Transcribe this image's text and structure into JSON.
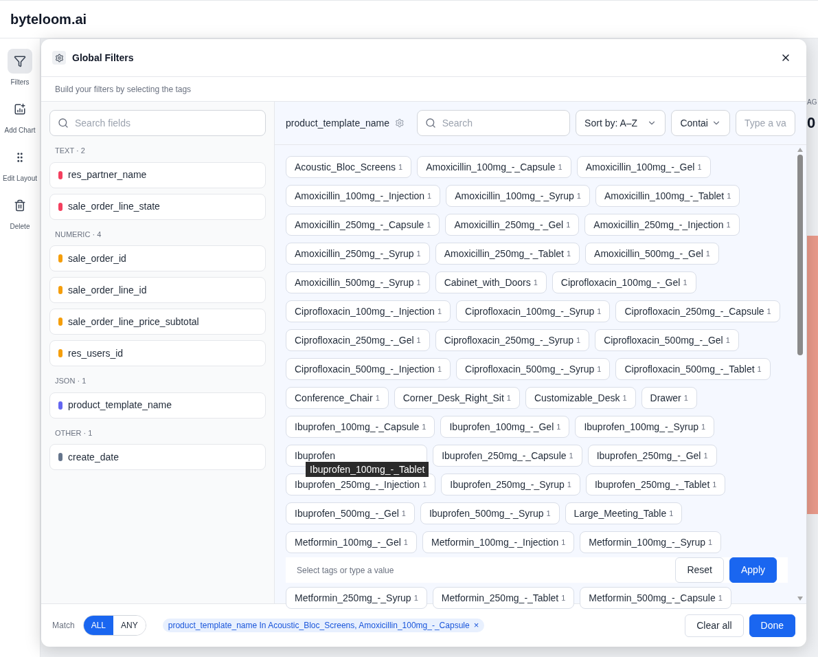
{
  "app": {
    "logo": "byteloom.ai"
  },
  "rail": [
    {
      "kind": "filter",
      "label": "Filters",
      "selected": true
    },
    {
      "kind": "chart",
      "label": "Add Chart",
      "selected": false
    },
    {
      "kind": "layout",
      "label": "Edit Layout",
      "selected": false
    },
    {
      "kind": "delete",
      "label": "Delete",
      "selected": false
    }
  ],
  "background": {
    "label": "AG",
    "value": "0"
  },
  "dialog": {
    "title": "Global Filters",
    "subtitle": "Build your filters by selecting the tags",
    "field_search": {
      "placeholder": "Search fields"
    },
    "groups": [
      {
        "title": "TEXT",
        "separator": "·",
        "count": "2",
        "fields": [
          {
            "name": "res_partner_name",
            "color": "#f43f5e"
          },
          {
            "name": "sale_order_line_state",
            "color": "#f43f5e"
          }
        ]
      },
      {
        "title": "NUMERIC",
        "separator": "·",
        "count": "4",
        "fields": [
          {
            "name": "sale_order_id",
            "color": "#f59e0b"
          },
          {
            "name": "sale_order_line_id",
            "color": "#f59e0b"
          },
          {
            "name": "sale_order_line_price_subtotal",
            "color": "#f59e0b"
          },
          {
            "name": "res_users_id",
            "color": "#f59e0b"
          }
        ]
      },
      {
        "title": "JSON",
        "separator": "·",
        "count": "1",
        "fields": [
          {
            "name": "product_template_name",
            "color": "#6366f1"
          }
        ]
      },
      {
        "title": "OTHER",
        "separator": "·",
        "count": "1",
        "fields": [
          {
            "name": "create_date",
            "color": "#64748b"
          }
        ]
      }
    ],
    "field_name": "product_template_name",
    "tag_search": {
      "placeholder": "Search"
    },
    "sort": "Sort by: A–Z",
    "operator": "Contai",
    "value_input": {
      "placeholder": "Type a va"
    },
    "tags": [
      {
        "label": "Acoustic_Bloc_Screens",
        "count": "1"
      },
      {
        "label": "Amoxicillin_100mg_-_Capsule",
        "count": "1"
      },
      {
        "label": "Amoxicillin_100mg_-_Gel",
        "count": "1"
      },
      {
        "label": "Amoxicillin_100mg_-_Injection",
        "count": "1"
      },
      {
        "label": "Amoxicillin_100mg_-_Syrup",
        "count": "1"
      },
      {
        "label": "Amoxicillin_100mg_-_Tablet",
        "count": "1"
      },
      {
        "label": "Amoxicillin_250mg_-_Capsule",
        "count": "1"
      },
      {
        "label": "Amoxicillin_250mg_-_Gel",
        "count": "1"
      },
      {
        "label": "Amoxicillin_250mg_-_Injection",
        "count": "1"
      },
      {
        "label": "Amoxicillin_250mg_-_Syrup",
        "count": "1"
      },
      {
        "label": "Amoxicillin_250mg_-_Tablet",
        "count": "1"
      },
      {
        "label": "Amoxicillin_500mg_-_Gel",
        "count": "1"
      },
      {
        "label": "Amoxicillin_500mg_-_Syrup",
        "count": "1"
      },
      {
        "label": "Cabinet_with_Doors",
        "count": "1"
      },
      {
        "label": "Ciprofloxacin_100mg_-_Gel",
        "count": "1"
      },
      {
        "label": "Ciprofloxacin_100mg_-_Injection",
        "count": "1"
      },
      {
        "label": "Ciprofloxacin_100mg_-_Syrup",
        "count": "1"
      },
      {
        "label": "Ciprofloxacin_250mg_-_Capsule",
        "count": "1"
      },
      {
        "label": "Ciprofloxacin_250mg_-_Gel",
        "count": "1"
      },
      {
        "label": "Ciprofloxacin_250mg_-_Syrup",
        "count": "1"
      },
      {
        "label": "Ciprofloxacin_500mg_-_Gel",
        "count": "1"
      },
      {
        "label": "Ciprofloxacin_500mg_-_Injection",
        "count": "1"
      },
      {
        "label": "Ciprofloxacin_500mg_-_Syrup",
        "count": "1"
      },
      {
        "label": "Ciprofloxacin_500mg_-_Tablet",
        "count": "1"
      },
      {
        "label": "Conference_Chair",
        "count": "1"
      },
      {
        "label": "Corner_Desk_Right_Sit",
        "count": "1"
      },
      {
        "label": "Customizable_Desk",
        "count": "1"
      },
      {
        "label": "Drawer",
        "count": "1"
      },
      {
        "label": "Ibuprofen_100mg_-_Capsule",
        "count": "1"
      },
      {
        "label": "Ibuprofen_100mg_-_Gel",
        "count": "1"
      },
      {
        "label": "Ibuprofen_100mg_-_Syrup",
        "count": "1"
      },
      {
        "label": "Ibuprofen",
        "tooltip": "Ibuprofen_100mg_-_Tablet"
      },
      {
        "label": "Ibuprofen_250mg_-_Capsule",
        "count": "1"
      },
      {
        "label": "Ibuprofen_250mg_-_Gel",
        "count": "1"
      },
      {
        "label": "Ibuprofen_250mg_-_Injection",
        "count": "1"
      },
      {
        "label": "Ibuprofen_250mg_-_Syrup",
        "count": "1"
      },
      {
        "label": "Ibuprofen_250mg_-_Tablet",
        "count": "1"
      },
      {
        "label": "Ibuprofen_500mg_-_Gel",
        "count": "1"
      },
      {
        "label": "Ibuprofen_500mg_-_Syrup",
        "count": "1"
      },
      {
        "label": "Large_Meeting_Table",
        "count": "1"
      },
      {
        "label": "Metformin_100mg_-_Gel",
        "count": "1"
      },
      {
        "label": "Metformin_100mg_-_Injection",
        "count": "1"
      },
      {
        "label": "Metformin_100mg_-_Syrup",
        "count": "1"
      }
    ],
    "action_bar": {
      "hint": "Select tags or type a value",
      "buttons": [
        {
          "label": "Reset",
          "kind": "secondary"
        },
        {
          "label": "Apply",
          "kind": "primary"
        }
      ]
    },
    "tags_below": [
      {
        "label": "Metformin_250mg_-_Syrup",
        "count": "1"
      },
      {
        "label": "Metformin_250mg_-_Tablet",
        "count": "1"
      },
      {
        "label": "Metformin_500mg_-_Capsule",
        "count": "1"
      }
    ],
    "footer": {
      "match_label": "Match",
      "match": [
        {
          "label": "ALL",
          "selected": true
        },
        {
          "label": "ANY",
          "selected": false
        }
      ],
      "active_filter": {
        "text": "product_template_name In Acoustic_Bloc_Screens, Amoxicillin_100mg_-_Capsule",
        "remove": "×"
      },
      "buttons": [
        {
          "label": "Clear all",
          "kind": "secondary"
        },
        {
          "label": "Done",
          "kind": "primary"
        }
      ]
    }
  }
}
